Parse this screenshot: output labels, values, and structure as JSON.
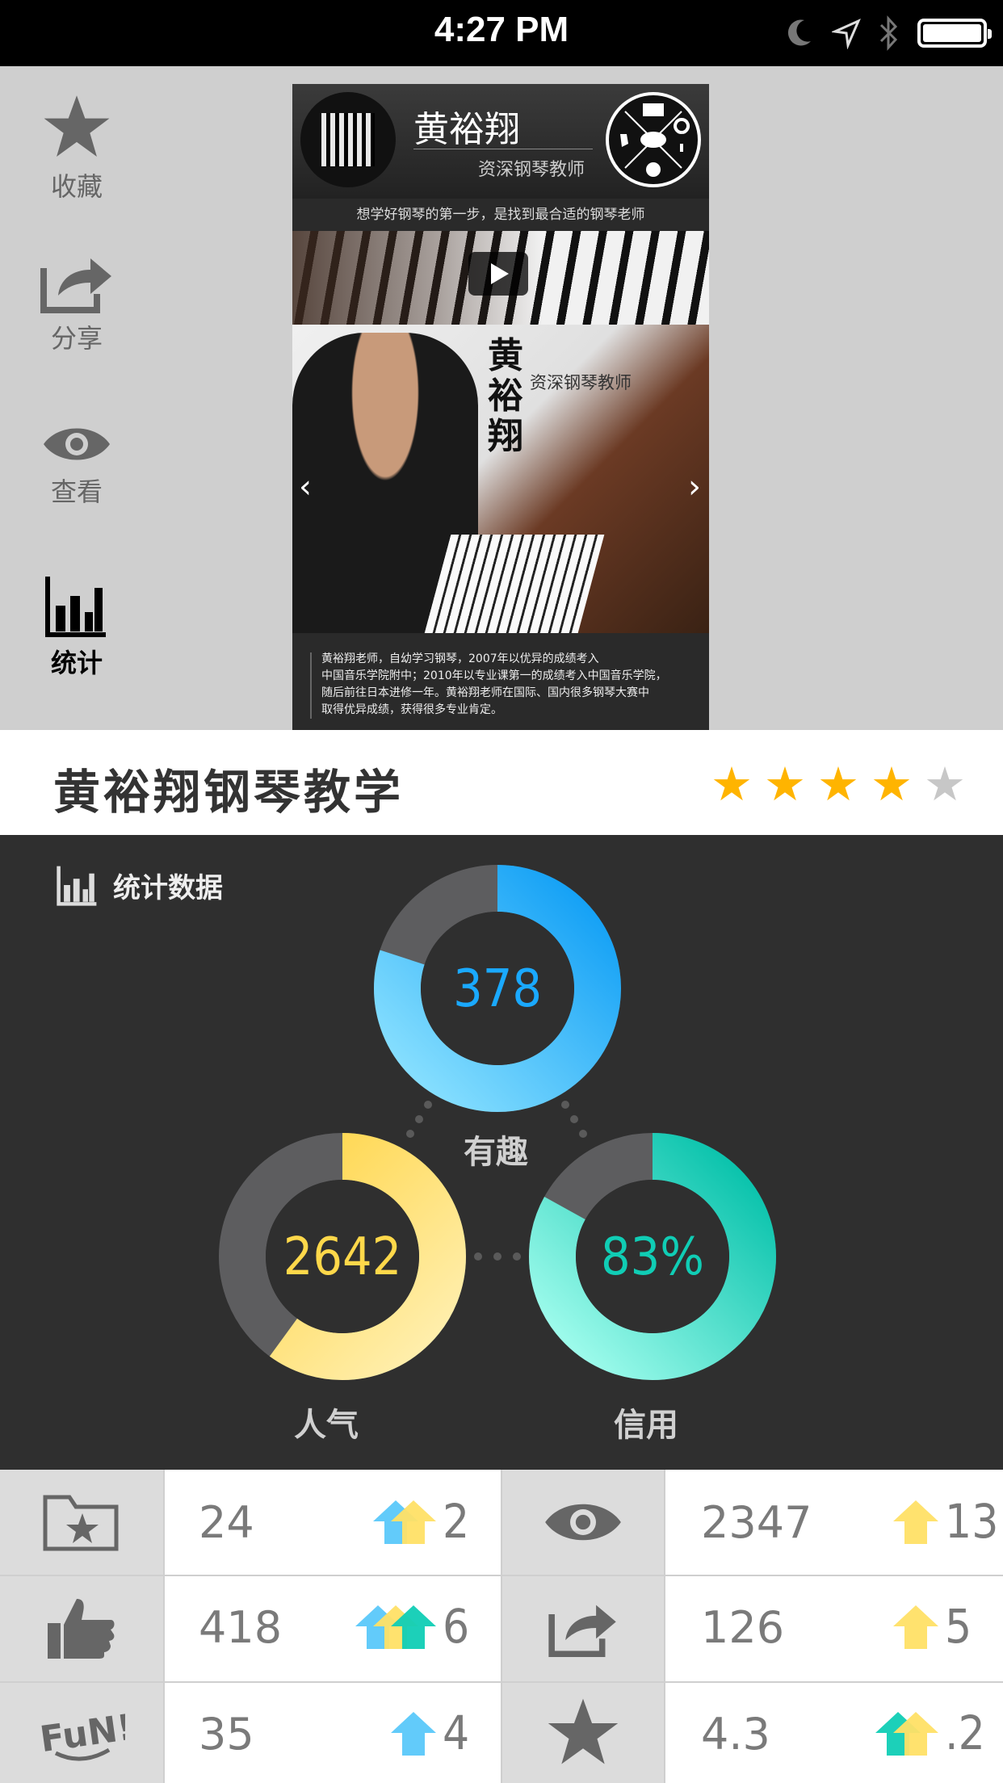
{
  "status_bar": {
    "time": "4:27 PM"
  },
  "sidebar": {
    "items": [
      {
        "label": "收藏",
        "icon": "star-icon"
      },
      {
        "label": "分享",
        "icon": "share-icon"
      },
      {
        "label": "查看",
        "icon": "eye-icon"
      },
      {
        "label": "统计",
        "icon": "bar-chart-icon",
        "active": true
      }
    ]
  },
  "preview": {
    "name": "黄裕翔",
    "title": "资深钢琴教师",
    "tagline": "想学好钢琴的第一步，是找到最合适的钢琴老师",
    "vertical_name": "黄裕翔",
    "vertical_title": "资深钢琴教师",
    "bio_lines": [
      "黄裕翔老师，自幼学习钢琴，2007年以优异的成绩考入",
      "中国音乐学院附中；2010年以专业课第一的成绩考入中国音乐学院，",
      "随后前往日本进修一年。黄裕翔老师在国际、国内很多钢琴大赛中",
      "取得优异成绩，获得很多专业肯定。"
    ]
  },
  "profile": {
    "title": "黄裕翔钢琴教学",
    "rating": 4,
    "rating_max": 5
  },
  "stats": {
    "heading": "统计数据",
    "rings": [
      {
        "value": "378",
        "label": "有趣",
        "fraction": 0.8,
        "color": "#1aa9ff"
      },
      {
        "value": "2642",
        "label": "人气",
        "fraction": 0.6,
        "color": "#ffd84a"
      },
      {
        "value": "83%",
        "label": "信用",
        "fraction": 0.83,
        "color": "#10cdb5"
      }
    ]
  },
  "table": {
    "rows": [
      {
        "left": {
          "icon": "folder-star-icon",
          "value": "24",
          "delta": "2",
          "arrows": [
            "#5ac8fa",
            "#ffe066"
          ]
        },
        "right": {
          "icon": "eye-icon",
          "value": "2347",
          "delta": "13",
          "arrows": [
            "#ffe066"
          ]
        }
      },
      {
        "left": {
          "icon": "thumbs-up-icon",
          "value": "418",
          "delta": "6",
          "arrows": [
            "#5ac8fa",
            "#ffe066",
            "#10cdb5"
          ]
        },
        "right": {
          "icon": "share-icon",
          "value": "126",
          "delta": "5",
          "arrows": [
            "#ffe066"
          ]
        }
      },
      {
        "left": {
          "icon": "fun-icon",
          "value": "35",
          "delta": "4",
          "arrows": [
            "#5ac8fa"
          ]
        },
        "right": {
          "icon": "star-icon",
          "value": "4.3",
          "delta": ".2",
          "arrows": [
            "#10cdb5",
            "#ffe066"
          ]
        }
      }
    ]
  }
}
